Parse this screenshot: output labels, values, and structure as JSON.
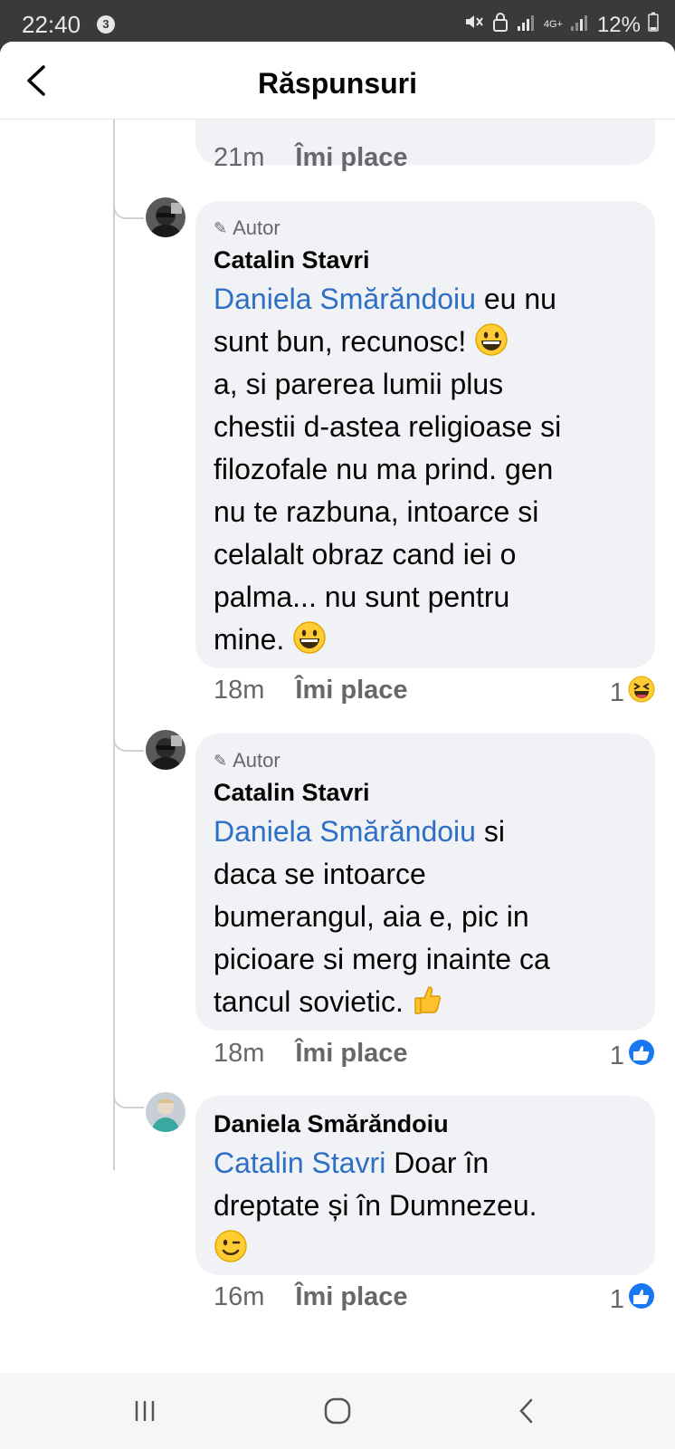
{
  "status_bar": {
    "time": "22:40",
    "notification_count": "3",
    "network": "4G+",
    "battery": "12%"
  },
  "header": {
    "title": "Răspunsuri"
  },
  "previous_comment": {
    "time": "21m",
    "like_label": "Îmi place"
  },
  "comments": [
    {
      "author_badge": "Autor",
      "name": "Catalin Stavri",
      "mention": "Daniela Smărăndoiu",
      "text_lines": [
        " eu nu",
        "sunt bun, recunosc!",
        "a, si parerea lumii plus",
        "chestii d-astea religioase si",
        "filozofale nu ma prind. gen",
        "nu te razbuna, intoarce si",
        "celalalt obraz cand iei o",
        "palma... nu sunt pentru",
        "mine."
      ],
      "time": "18m",
      "like_label": "Îmi place",
      "reaction_count": "1",
      "reaction_icon": "laughing-face-icon"
    },
    {
      "author_badge": "Autor",
      "name": "Catalin Stavri",
      "mention": "Daniela Smărăndoiu",
      "text_lines": [
        " si",
        "daca se intoarce",
        "bumerangul, aia e, pic in",
        "picioare si merg inainte ca",
        "tancul sovietic."
      ],
      "time": "18m",
      "like_label": "Îmi place",
      "reaction_count": "1",
      "reaction_icon": "like-thumb-icon"
    },
    {
      "name": "Daniela Smărăndoiu",
      "mention": "Catalin Stavri",
      "text_lines": [
        " Doar în",
        "dreptate și în Dumnezeu."
      ],
      "time": "16m",
      "like_label": "Îmi place",
      "reaction_count": "1",
      "reaction_icon": "like-thumb-icon"
    }
  ],
  "colors": {
    "mention": "#2e6fc6",
    "bubble": "#f0f2f5",
    "meta": "#65676b",
    "like_blue": "#1877f2"
  }
}
